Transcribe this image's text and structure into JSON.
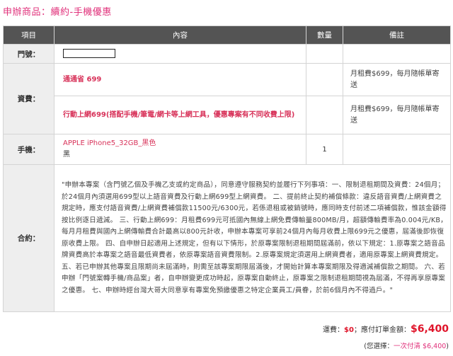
{
  "page_title": "申辦商品：續約-手機優惠",
  "table": {
    "headers": {
      "item": "項目",
      "content": "內容",
      "qty": "數量",
      "note": "備註"
    }
  },
  "rows": {
    "door_number": {
      "label": "門號："
    },
    "fee": {
      "label": "資費：",
      "plan1_name": "通通省 699",
      "plan1_note": "月租費$699，每月隨帳單寄送",
      "plan2_name": "行動上網699(搭配手機/筆電/網卡等上網工具，優惠專案有不同收費上限)",
      "plan2_note": "月租費$699，每月隨帳單寄送"
    },
    "phone": {
      "label": "手機：",
      "model": "APPLE iPhone5_32GB_黑色",
      "color": "黑",
      "qty": "1"
    },
    "contract": {
      "label": "合約：",
      "text": "\"申辦本專案（含門號乙個及手機乙支或約定商品），同意遵守服務契約並履行下列事項：一、限制退租期間及資費：24個月；於24個月內須選用699型以上語音資費及行動上網699型上網資費。 二、提前終止契約補償條款：違反語音資費/上網資費之規定時，應支付語音資費/上網資費補償款11500元/6300元，若係退租或被銷號時，應同時支付前述二項補償款，惟該金額得按比例逐日遞減。 三、行動上網699：月租費699元可抵國內無線上網免費傳輸量800MB/月，超額傳輸費率為0.004元/KB，每月月租費與國內上網傳輸費合計最高以800元計收，申辦本專案可享前24個月內每月收費上限699元之優惠，屆滿後即恢復原收費上限。 四、自申辦日起適用上述規定，但有以下情形，於原專案限制退租期間屆滿前，依以下規定：1.原專案之語音品牌資費高於本專案之語音最低資費者，依原專案語音資費限制。2.原專案規定須選用上網資費者，適用原專案上網資費規定。 五、若已申辦其他專案且限期尚未屆滿時，則需至該專案期限屆滿後，才開始計算本專案期限及得適減補償款之期間。 六、若申辦「門號案轉手機/商品案」者，自申辦變更成功時起，原專案自動終止，原專案之限制退租期間視為屆滿，不得再享原專案之優惠。 七、申辦時經台灣大哥大同意享有專案免預繳優惠之特定企業員工/員眷，於前6個月內不得過戶。\""
    }
  },
  "summary": {
    "shipping_label": "運費：",
    "shipping_value": "$0",
    "total_label": "；應付訂單金額：",
    "total_value": "$6,400",
    "selected_open": "(您選擇：",
    "selected_value": "一次付清 $6,400",
    "selected_close": ")"
  }
}
